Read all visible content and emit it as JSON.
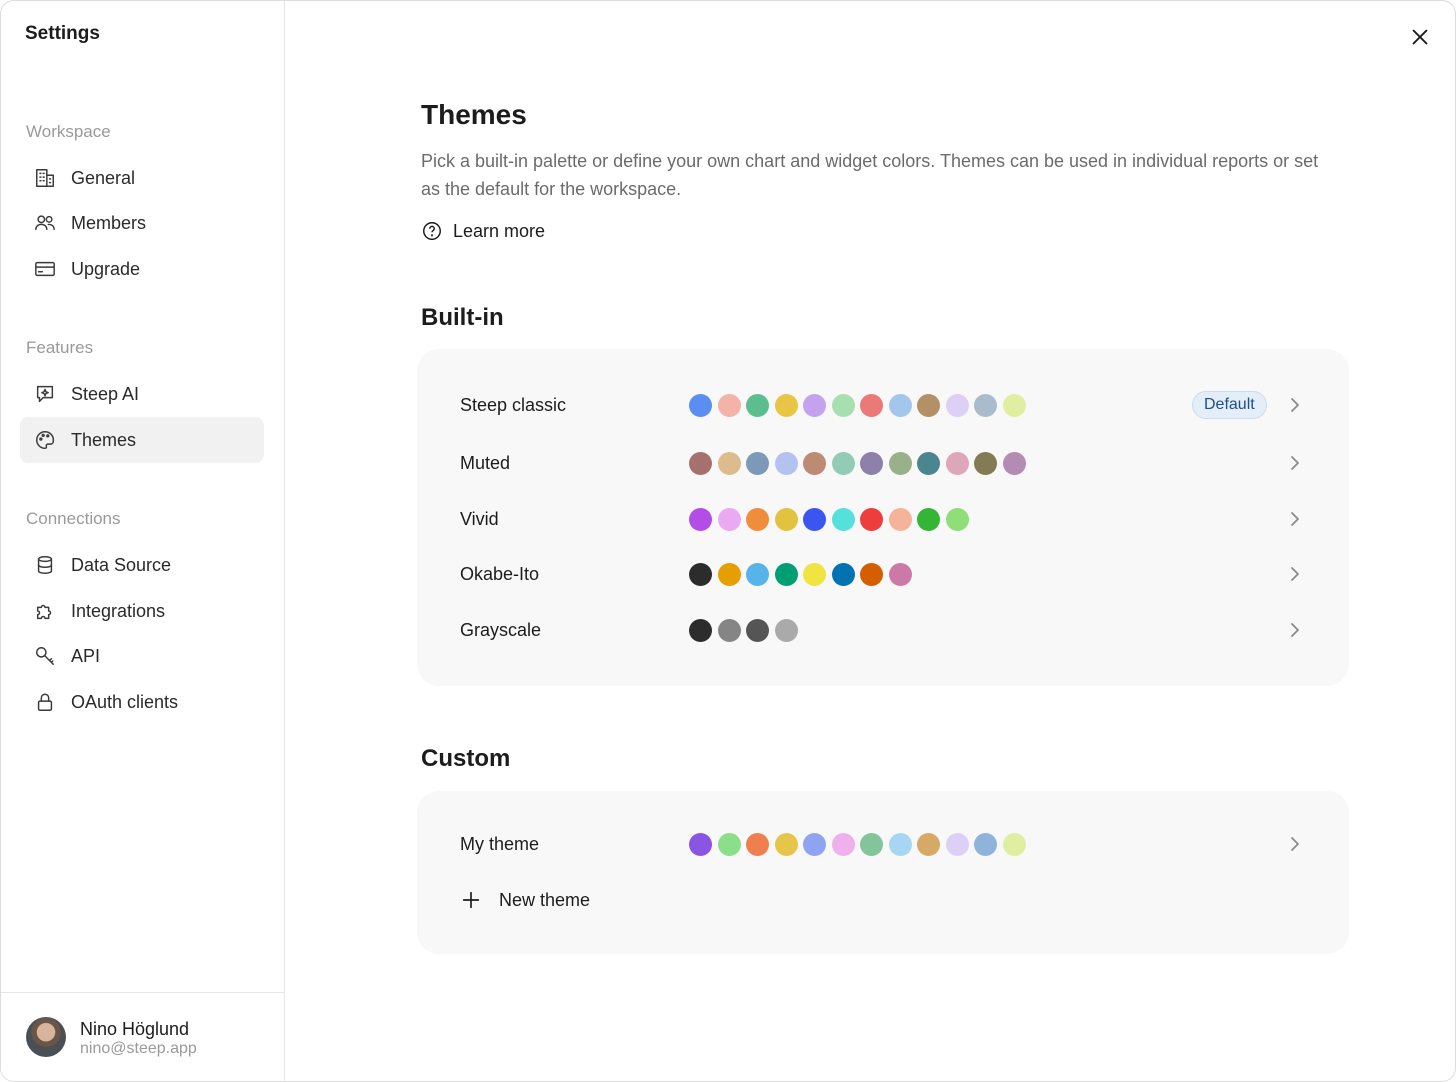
{
  "sidebar": {
    "title": "Settings",
    "sections": [
      {
        "label": "Workspace",
        "items": [
          {
            "label": "General",
            "icon": "building-icon"
          },
          {
            "label": "Members",
            "icon": "users-icon"
          },
          {
            "label": "Upgrade",
            "icon": "credit-card-icon"
          }
        ]
      },
      {
        "label": "Features",
        "items": [
          {
            "label": "Steep AI",
            "icon": "chat-sparkle-icon"
          },
          {
            "label": "Themes",
            "icon": "palette-icon",
            "active": true
          }
        ]
      },
      {
        "label": "Connections",
        "items": [
          {
            "label": "Data Source",
            "icon": "database-icon"
          },
          {
            "label": "Integrations",
            "icon": "puzzle-icon"
          },
          {
            "label": "API",
            "icon": "key-icon"
          },
          {
            "label": "OAuth clients",
            "icon": "lock-icon"
          }
        ]
      }
    ],
    "user": {
      "name": "Nino Höglund",
      "email": "nino@steep.app"
    }
  },
  "main": {
    "title": "Themes",
    "description": "Pick a built-in palette or define your own chart and widget colors. Themes can be used in individual reports or set as the default for the workspace.",
    "learn_more": "Learn more",
    "builtin": {
      "title": "Built-in",
      "themes": [
        {
          "name": "Steep classic",
          "badge": "Default",
          "colors": [
            "#5b8ef0",
            "#f3b3a8",
            "#5cbd8e",
            "#e8c544",
            "#c5a2ee",
            "#a8dfb1",
            "#e97a78",
            "#a3c6ec",
            "#b39066",
            "#ddd0f7",
            "#a8bccc",
            "#dfeea0"
          ]
        },
        {
          "name": "Muted",
          "colors": [
            "#a6706f",
            "#dcbc8d",
            "#7c9ab8",
            "#b3c3ef",
            "#bd8a73",
            "#93ccb6",
            "#8d80ab",
            "#98b18a",
            "#4b8590",
            "#dea6b9",
            "#837b55",
            "#b48cb3"
          ]
        },
        {
          "name": "Vivid",
          "colors": [
            "#b34de8",
            "#eaaaf1",
            "#ef8d3c",
            "#e2c33f",
            "#3a55f0",
            "#55e0db",
            "#ee3d3d",
            "#f5b399",
            "#35b536",
            "#8fde78"
          ]
        },
        {
          "name": "Okabe-Ito",
          "colors": [
            "#2c2c2c",
            "#e59f00",
            "#56b4e9",
            "#009e73",
            "#f0e442",
            "#0072b2",
            "#d55e00",
            "#cc79a7"
          ]
        },
        {
          "name": "Grayscale",
          "colors": [
            "#2d2d2d",
            "#858585",
            "#555555",
            "#aaaaaa"
          ]
        }
      ]
    },
    "custom": {
      "title": "Custom",
      "themes": [
        {
          "name": "My theme",
          "colors": [
            "#8b55e3",
            "#8cdf8a",
            "#ef7f4e",
            "#e6c64a",
            "#8ea4f1",
            "#efb1eb",
            "#83c49a",
            "#a7d6f2",
            "#d7a966",
            "#ddd0f7",
            "#8fb4dc",
            "#dfeea0"
          ]
        }
      ],
      "new_theme": "New theme"
    }
  }
}
